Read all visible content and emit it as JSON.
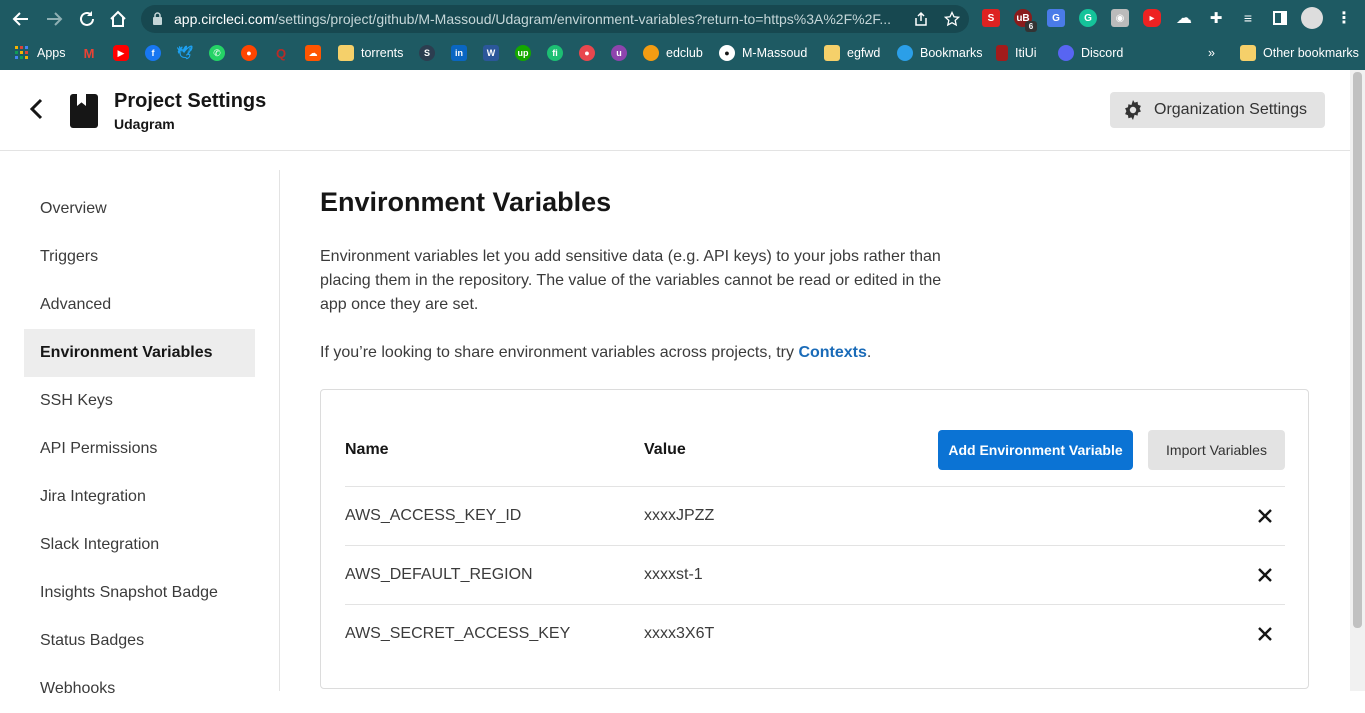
{
  "browser": {
    "url_host": "app.circleci.com",
    "url_path": "/settings/project/github/M-Massoud/Udagram/environment-variables?return-to=https%3A%2F%2F...",
    "extension_badge": "6",
    "bookmarks": [
      {
        "label": "Apps",
        "icon": "apps-grid-icon"
      },
      {
        "label": "torrents",
        "icon": "folder-icon"
      },
      {
        "label": "edclub",
        "icon": "edclub-icon"
      },
      {
        "label": "M-Massoud",
        "icon": "github-icon"
      },
      {
        "label": "egfwd",
        "icon": "folder-icon"
      },
      {
        "label": "Bookmarks",
        "icon": "cloud-icon"
      },
      {
        "label": "ItiUi",
        "icon": "figma-icon"
      },
      {
        "label": "Discord",
        "icon": "discord-icon"
      }
    ],
    "other_bookmarks": "Other bookmarks",
    "overflow": "»"
  },
  "header": {
    "title": "Project Settings",
    "subtitle": "Udagram",
    "org_settings_label": "Organization Settings"
  },
  "sidebar": {
    "items": [
      {
        "label": "Overview"
      },
      {
        "label": "Triggers"
      },
      {
        "label": "Advanced"
      },
      {
        "label": "Environment Variables",
        "active": true
      },
      {
        "label": "SSH Keys"
      },
      {
        "label": "API Permissions"
      },
      {
        "label": "Jira Integration"
      },
      {
        "label": "Slack Integration"
      },
      {
        "label": "Insights Snapshot Badge"
      },
      {
        "label": "Status Badges"
      },
      {
        "label": "Webhooks"
      }
    ]
  },
  "main": {
    "title": "Environment Variables",
    "description": "Environment variables let you add sensitive data (e.g. API keys) to your jobs rather than placing them in the repository. The value of the variables cannot be read or edited in the app once they are set.",
    "share_text": "If you’re looking to share environment variables across projects, try ",
    "share_link": "Contexts",
    "share_end": ".",
    "table": {
      "col_name": "Name",
      "col_value": "Value",
      "add_button": "Add Environment Variable",
      "import_button": "Import Variables",
      "rows": [
        {
          "name": "AWS_ACCESS_KEY_ID",
          "value": "xxxxJPZZ"
        },
        {
          "name": "AWS_DEFAULT_REGION",
          "value": "xxxxst-1"
        },
        {
          "name": "AWS_SECRET_ACCESS_KEY",
          "value": "xxxx3X6T"
        }
      ]
    }
  },
  "colors": {
    "chrome_bg": "#1e5a63",
    "primary_button": "#0b73d4",
    "link": "#1a6bb8",
    "active_nav_bg": "#ededed"
  }
}
